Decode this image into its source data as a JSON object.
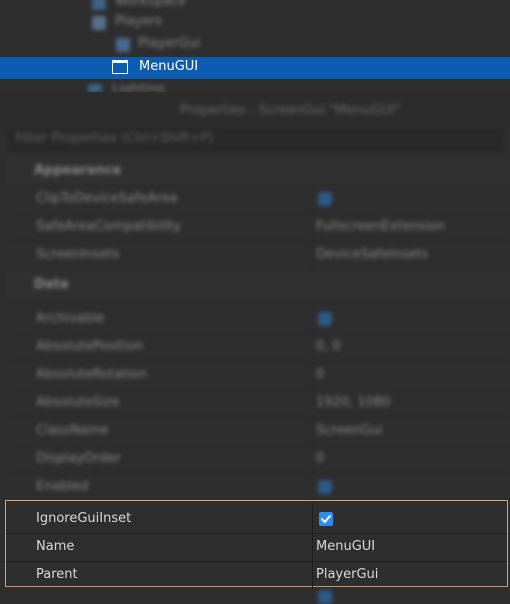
{
  "explorer": {
    "rows_blurred": [
      "Workspace",
      "Players",
      "Lighting",
      "PlayerGui"
    ],
    "selected": {
      "label": "MenuGUI",
      "icon": "screen-gui-icon"
    }
  },
  "properties": {
    "title": "Properties - ScreenGui \"MenuGUI\"",
    "filter_placeholder": "Filter Properties (Ctrl+Shift+P)",
    "blurred_rows": [
      {
        "name": "Appearance",
        "value": "",
        "section": true
      },
      {
        "name": "ClipToDeviceSafeArea",
        "value": "",
        "check": true
      },
      {
        "name": "SafeAreaCompatibility",
        "value": "FullscreenExtension"
      },
      {
        "name": "ScreenInsets",
        "value": "DeviceSafeInsets"
      },
      {
        "name": "Data",
        "value": "",
        "section": true
      },
      {
        "name": "Archivable",
        "value": "",
        "check": true
      },
      {
        "name": "AbsolutePosition",
        "value": "0, 0"
      },
      {
        "name": "AbsoluteRotation",
        "value": "0"
      },
      {
        "name": "AbsoluteSize",
        "value": "1920, 1080"
      },
      {
        "name": "ClassName",
        "value": "ScreenGui"
      },
      {
        "name": "DisplayOrder",
        "value": "0"
      },
      {
        "name": "Enabled",
        "value": "",
        "check": true
      }
    ],
    "focused_rows": [
      {
        "name": "IgnoreGuiInset",
        "value": "",
        "checked": true
      },
      {
        "name": "Name",
        "value": "MenuGUI"
      },
      {
        "name": "Parent",
        "value": "PlayerGui"
      }
    ]
  },
  "colors": {
    "selection": "#0b5cb1",
    "checkbox": "#2d8ef0",
    "focus_border": "#d9a96a",
    "background": "#2e2e2e"
  }
}
